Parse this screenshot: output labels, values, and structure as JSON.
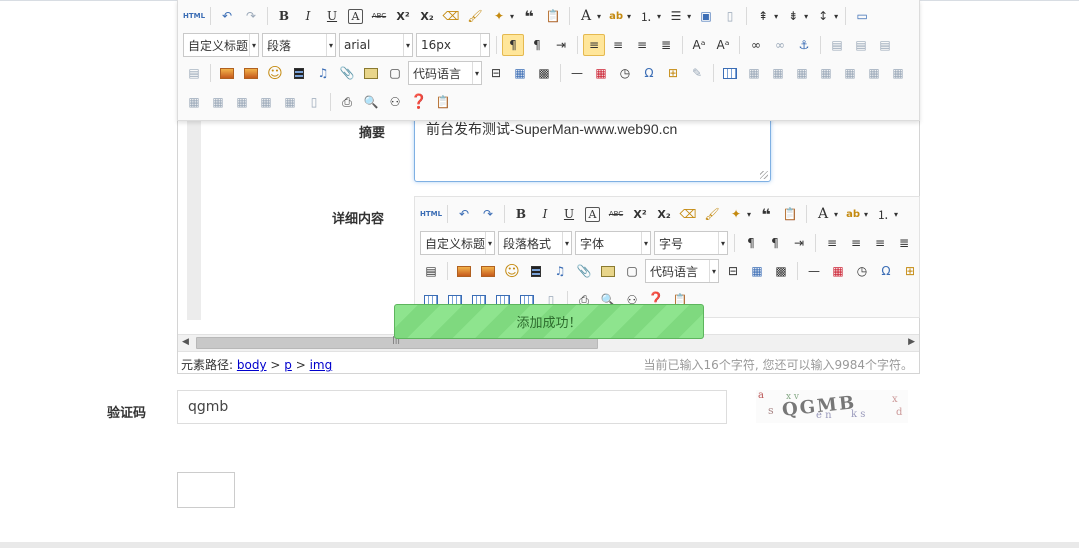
{
  "fields": {
    "summary_label": "摘要",
    "summary_value": "前台发布测试-SuperMan-www.web90.cn",
    "detail_label": "详细内容",
    "captcha_label": "验证码",
    "captcha_value": "qgmb",
    "captcha_image_text": "QGMB",
    "submit_label": ""
  },
  "main_toolbar": {
    "paragraph_combo": "自定义标题",
    "format_combo": "段落",
    "font_combo": "arial",
    "size_combo": "16px",
    "code_lang_combo": "代码语言"
  },
  "inner_toolbar": {
    "paragraph_combo": "自定义标题",
    "format_combo": "段落格式",
    "font_combo": "字体",
    "size_combo": "字号",
    "code_lang_combo": "代码语言"
  },
  "icons": {
    "html": "HTML",
    "bold": "B",
    "italic": "I",
    "underline": "U",
    "strike": "ABC",
    "superscript": "X²",
    "subscript": "X₂",
    "font_color": "A",
    "omega": "Ω"
  },
  "statusbar": {
    "path_prefix": "元素路径:",
    "path_body": "body",
    "path_sep1": " > ",
    "path_p": "p",
    "path_sep2": " > ",
    "path_img": "img",
    "word_count": "当前已输入16个字符, 您还可以输入9984个字符。"
  },
  "toast": {
    "message": "添加成功！"
  },
  "colors": {
    "toast_bg": "#8ee48e",
    "link": "#0000cc",
    "focus_border": "#7fb0e3",
    "active_button": "#ffe69a"
  }
}
